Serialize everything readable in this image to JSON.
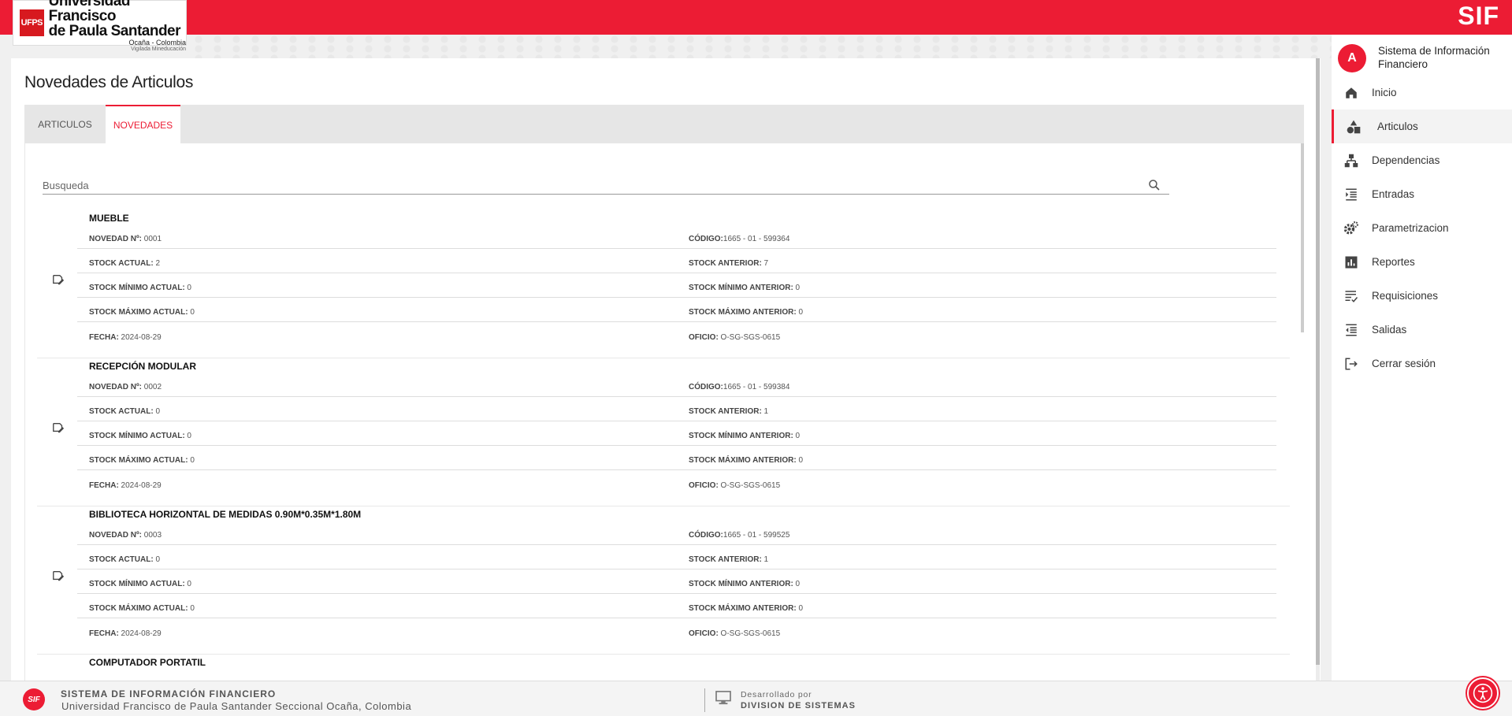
{
  "header": {
    "logo": {
      "mark": "UFPS",
      "line1": "Universidad Francisco",
      "line2": "de Paula Santander",
      "line3": "Ocaña - Colombia",
      "line4": "Vigilada Mineducación"
    },
    "brand": "SIF",
    "accent_color": "#ec1c34"
  },
  "main": {
    "title": "Novedades de Articulos",
    "tabs": [
      {
        "label": "ARTICULOS",
        "active": false
      },
      {
        "label": "NOVEDADES",
        "active": true
      }
    ],
    "search": {
      "placeholder": "Busqueda",
      "value": "",
      "icon": "search-icon"
    },
    "entries": [
      {
        "title": "MUEBLE",
        "icon": "edit-document-icon",
        "rows": [
          {
            "l_label": "NOVEDAD Nº:",
            "l_value": " 0001",
            "r_label": "CÓDIGO:",
            "r_value": "1665 - 01 - 599364"
          },
          {
            "l_label": "STOCK ACTUAL:",
            "l_value": " 2",
            "r_label": "STOCK ANTERIOR:",
            "r_value": " 7"
          },
          {
            "l_label": "STOCK MÍNIMO ACTUAL:",
            "l_value": " 0",
            "r_label": "STOCK MÍNIMO ANTERIOR:",
            "r_value": " 0"
          },
          {
            "l_label": "STOCK MÁXIMO ACTUAL:",
            "l_value": " 0",
            "r_label": "STOCK MÁXIMO ANTERIOR:",
            "r_value": " 0"
          },
          {
            "l_label": "FECHA:",
            "l_value": " 2024-08-29",
            "r_label": "OFICIO:",
            "r_value": " O-SG-SGS-0615"
          }
        ]
      },
      {
        "title": "RECEPCIÓN MODULAR",
        "icon": "edit-document-icon",
        "rows": [
          {
            "l_label": "NOVEDAD Nº:",
            "l_value": " 0002",
            "r_label": "CÓDIGO:",
            "r_value": "1665 - 01 - 599384"
          },
          {
            "l_label": "STOCK ACTUAL:",
            "l_value": " 0",
            "r_label": "STOCK ANTERIOR:",
            "r_value": " 1"
          },
          {
            "l_label": "STOCK MÍNIMO ACTUAL:",
            "l_value": " 0",
            "r_label": "STOCK MÍNIMO ANTERIOR:",
            "r_value": " 0"
          },
          {
            "l_label": "STOCK MÁXIMO ACTUAL:",
            "l_value": " 0",
            "r_label": "STOCK MÁXIMO ANTERIOR:",
            "r_value": " 0"
          },
          {
            "l_label": "FECHA:",
            "l_value": " 2024-08-29",
            "r_label": "OFICIO:",
            "r_value": " O-SG-SGS-0615"
          }
        ]
      },
      {
        "title": "BIBLIOTECA HORIZONTAL DE MEDIDAS 0.90M*0.35M*1.80M",
        "icon": "edit-document-icon",
        "rows": [
          {
            "l_label": "NOVEDAD Nº:",
            "l_value": " 0003",
            "r_label": "CÓDIGO:",
            "r_value": "1665 - 01 - 599525"
          },
          {
            "l_label": "STOCK ACTUAL:",
            "l_value": " 0",
            "r_label": "STOCK ANTERIOR:",
            "r_value": " 1"
          },
          {
            "l_label": "STOCK MÍNIMO ACTUAL:",
            "l_value": " 0",
            "r_label": "STOCK MÍNIMO ANTERIOR:",
            "r_value": " 0"
          },
          {
            "l_label": "STOCK MÁXIMO ACTUAL:",
            "l_value": " 0",
            "r_label": "STOCK MÁXIMO ANTERIOR:",
            "r_value": " 0"
          },
          {
            "l_label": "FECHA:",
            "l_value": " 2024-08-29",
            "r_label": "OFICIO:",
            "r_value": " O-SG-SGS-0615"
          }
        ]
      },
      {
        "title": "COMPUTADOR PORTATIL",
        "icon": "edit-document-icon",
        "rows": []
      }
    ]
  },
  "sidebar": {
    "avatar_letter": "A",
    "title": "Sistema de Información Financiero",
    "items": [
      {
        "label": "Inicio",
        "icon": "home-icon",
        "active": false
      },
      {
        "label": "Articulos",
        "icon": "shapes-icon",
        "active": true
      },
      {
        "label": "Dependencias",
        "icon": "hierarchy-icon",
        "active": false
      },
      {
        "label": "Entradas",
        "icon": "indent-icon",
        "active": false
      },
      {
        "label": "Parametrizacion",
        "icon": "settings-gears-icon",
        "active": false
      },
      {
        "label": "Reportes",
        "icon": "bar-chart-icon",
        "active": false
      },
      {
        "label": "Requisiciones",
        "icon": "checklist-icon",
        "active": false
      },
      {
        "label": "Salidas",
        "icon": "outdent-icon",
        "active": false
      },
      {
        "label": "Cerrar sesión",
        "icon": "logout-icon",
        "active": false
      }
    ]
  },
  "footer": {
    "logo": "SIF",
    "line1": "SISTEMA DE INFORMACIÓN FINANCIERO",
    "line2": "Universidad Francisco de Paula Santander Seccional Ocaña, Colombia",
    "dev_label": "Desarrollado por",
    "dev_name": "DIVISION DE SISTEMAS"
  }
}
